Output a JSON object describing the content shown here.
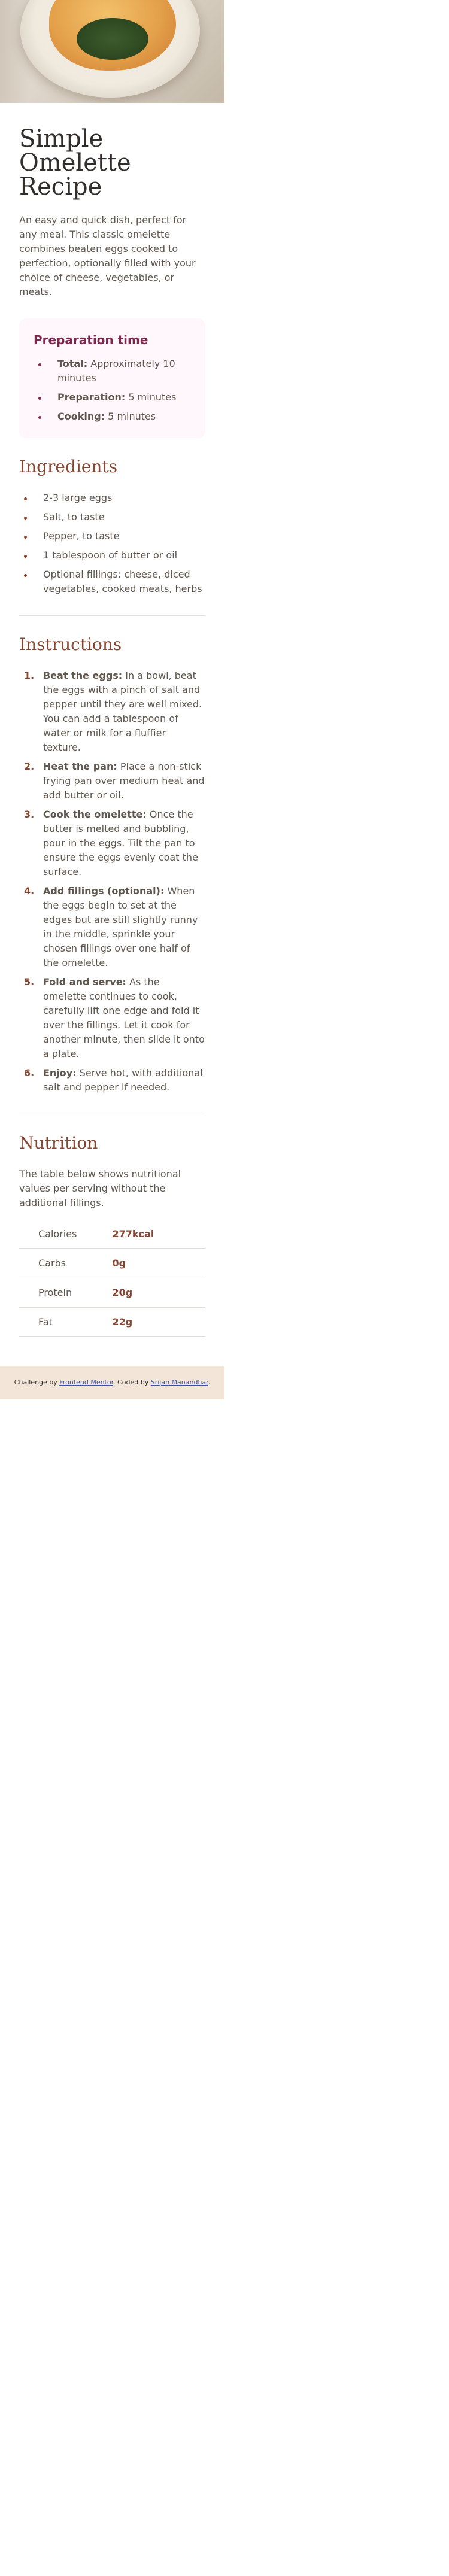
{
  "hero": {
    "image_alt": "omelette-photo"
  },
  "title": "Simple Omelette Recipe",
  "intro": "An easy and quick dish, perfect for any meal. This classic omelette combines beaten eggs cooked to perfection, optionally filled with your choice of cheese, vegetables, or meats.",
  "prep": {
    "heading": "Preparation time",
    "items": [
      {
        "label": "Total:",
        "text": " Approximately 10 minutes"
      },
      {
        "label": "Preparation:",
        "text": " 5 minutes"
      },
      {
        "label": "Cooking:",
        "text": " 5 minutes"
      }
    ]
  },
  "ingredients": {
    "heading": "Ingredients",
    "items": [
      "2-3 large eggs",
      "Salt, to taste",
      "Pepper, to taste",
      "1 tablespoon of butter or oil",
      "Optional fillings: cheese, diced vegetables, cooked meats, herbs"
    ]
  },
  "instructions": {
    "heading": "Instructions",
    "steps": [
      {
        "num": "1.",
        "label": "Beat the eggs:",
        "text": " In a bowl, beat the eggs with a pinch of salt and pepper until they are well mixed. You can add a tablespoon of water or milk for a fluffier texture."
      },
      {
        "num": "2.",
        "label": "Heat the pan:",
        "text": " Place a non-stick frying pan over medium heat and add butter or oil."
      },
      {
        "num": "3.",
        "label": "Cook the omelette:",
        "text": " Once the butter is melted and bubbling, pour in the eggs. Tilt the pan to ensure the eggs evenly coat the surface."
      },
      {
        "num": "4.",
        "label": "Add fillings (optional):",
        "text": " When the eggs begin to set at the edges but are still slightly runny in the middle, sprinkle your chosen fillings over one half of the omelette."
      },
      {
        "num": "5.",
        "label": "Fold and serve:",
        "text": " As the omelette continues to cook, carefully lift one edge and fold it over the fillings. Let it cook for another minute, then slide it onto a plate."
      },
      {
        "num": "6.",
        "label": "Enjoy:",
        "text": " Serve hot, with additional salt and pepper if needed."
      }
    ]
  },
  "nutrition": {
    "heading": "Nutrition",
    "description": "The table below shows nutritional values per serving without the additional fillings.",
    "rows": [
      {
        "name": "Calories",
        "value": "277kcal"
      },
      {
        "name": "Carbs",
        "value": "0g"
      },
      {
        "name": "Protein",
        "value": "20g"
      },
      {
        "name": "Fat",
        "value": "22g"
      }
    ]
  },
  "attribution": {
    "prefix": "Challenge by ",
    "fm_link": "Frontend Mentor",
    "middle": ". Coded by ",
    "author_link": "Srijan Manandhar",
    "suffix": "."
  }
}
